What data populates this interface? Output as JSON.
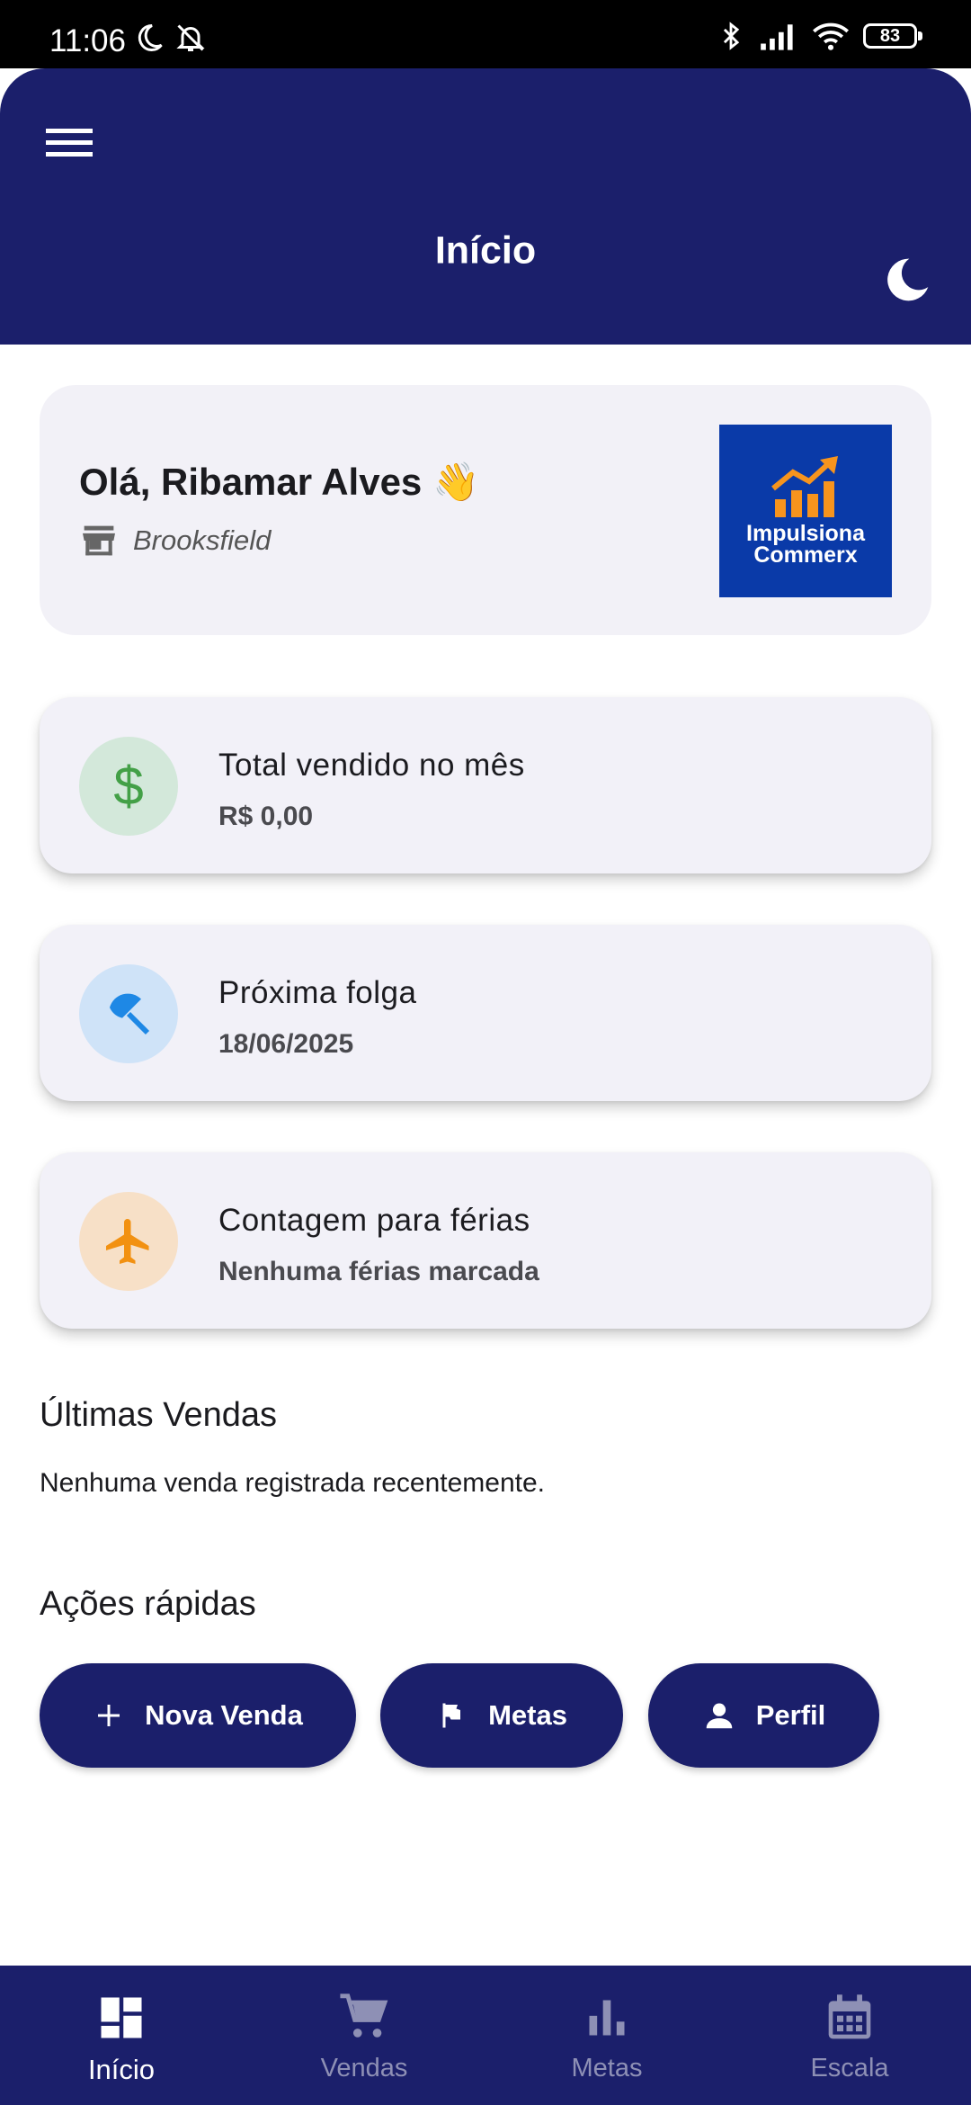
{
  "status_bar": {
    "time": "11:06",
    "battery": "83"
  },
  "app_bar": {
    "title": "Início"
  },
  "greeting": {
    "text": "Olá, Ribamar Alves 👋",
    "store": "Brooksfield",
    "logo_line1": "Impulsiona",
    "logo_line2": "Commerx"
  },
  "cards": [
    {
      "title": "Total vendido no mês",
      "value": "R$ 0,00",
      "icon": "dollar-icon",
      "icon_bg": "#d3e8da",
      "icon_color": "#43a047"
    },
    {
      "title": "Próxima folga",
      "value": "18/06/2025",
      "icon": "beach-umbrella-icon",
      "icon_bg": "#cfe3f8",
      "icon_color": "#1e88e5"
    },
    {
      "title": "Contagem para férias",
      "value": "Nenhuma férias marcada",
      "icon": "airplane-icon",
      "icon_bg": "#f7e0c7",
      "icon_color": "#f29111"
    }
  ],
  "recent_sales": {
    "title": "Últimas Vendas",
    "empty": "Nenhuma venda registrada recentemente."
  },
  "quick_actions": {
    "title": "Ações rápidas",
    "buttons": [
      {
        "label": "Nova Venda",
        "icon": "plus-icon"
      },
      {
        "label": "Metas",
        "icon": "flag-icon"
      },
      {
        "label": "Perfil",
        "icon": "person-icon"
      }
    ]
  },
  "bottom_nav": [
    {
      "label": "Início",
      "icon": "dashboard-icon",
      "active": true
    },
    {
      "label": "Vendas",
      "icon": "cart-icon",
      "active": false
    },
    {
      "label": "Metas",
      "icon": "bar-chart-icon",
      "active": false
    },
    {
      "label": "Escala",
      "icon": "calendar-icon",
      "active": false
    }
  ],
  "colors": {
    "primary": "#1b1f6b",
    "card_bg": "#f2f1f8",
    "logo_bg": "#0a3aa8",
    "logo_accent": "#f7941d"
  }
}
